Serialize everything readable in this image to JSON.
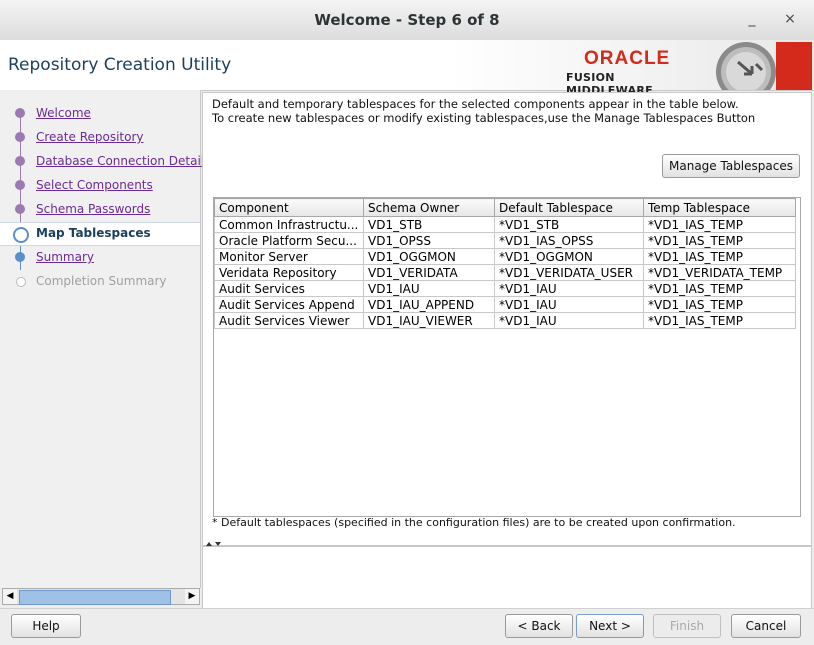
{
  "window": {
    "title": "Welcome - Step 6 of 8",
    "minimize": "_",
    "close": "×"
  },
  "header": {
    "app_title": "Repository Creation Utility",
    "oracle": "ORACLE",
    "fusion": "FUSION MIDDLEWARE"
  },
  "nav": {
    "steps": [
      {
        "label": "Welcome",
        "state": "visited"
      },
      {
        "label": "Create Repository",
        "state": "visited"
      },
      {
        "label": "Database Connection Details",
        "state": "visited"
      },
      {
        "label": "Select Components",
        "state": "visited"
      },
      {
        "label": "Schema Passwords",
        "state": "visited"
      },
      {
        "label": "Map Tablespaces",
        "state": "current"
      },
      {
        "label": "Summary",
        "state": "visited"
      },
      {
        "label": "Completion Summary",
        "state": "disabled"
      }
    ]
  },
  "content": {
    "desc_line1": "Default and temporary tablespaces for the selected components appear in the table below.",
    "desc_line2": "To create new tablespaces or modify existing tablespaces,use the Manage Tablespaces Button",
    "manage_button": "Manage Tablespaces",
    "table": {
      "headers": [
        "Component",
        "Schema Owner",
        "Default Tablespace",
        "Temp Tablespace"
      ],
      "rows": [
        [
          "Common Infrastructu...",
          "VD1_STB",
          "*VD1_STB",
          "*VD1_IAS_TEMP"
        ],
        [
          "Oracle Platform Secu...",
          "VD1_OPSS",
          "*VD1_IAS_OPSS",
          "*VD1_IAS_TEMP"
        ],
        [
          "Monitor Server",
          "VD1_OGGMON",
          "*VD1_OGGMON",
          "*VD1_IAS_TEMP"
        ],
        [
          "Veridata Repository",
          "VD1_VERIDATA",
          "*VD1_VERIDATA_USER",
          "*VD1_VERIDATA_TEMP"
        ],
        [
          "Audit Services",
          "VD1_IAU",
          "*VD1_IAU",
          "*VD1_IAS_TEMP"
        ],
        [
          "Audit Services Append",
          "VD1_IAU_APPEND",
          "*VD1_IAU",
          "*VD1_IAS_TEMP"
        ],
        [
          "Audit Services Viewer",
          "VD1_IAU_VIEWER",
          "*VD1_IAU",
          "*VD1_IAS_TEMP"
        ]
      ]
    },
    "footnote": "* Default tablespaces (specified in the configuration files) are to be created upon confirmation."
  },
  "buttons": {
    "help": "Help",
    "back": "< Back",
    "next": "Next >",
    "finish": "Finish",
    "cancel": "Cancel"
  }
}
